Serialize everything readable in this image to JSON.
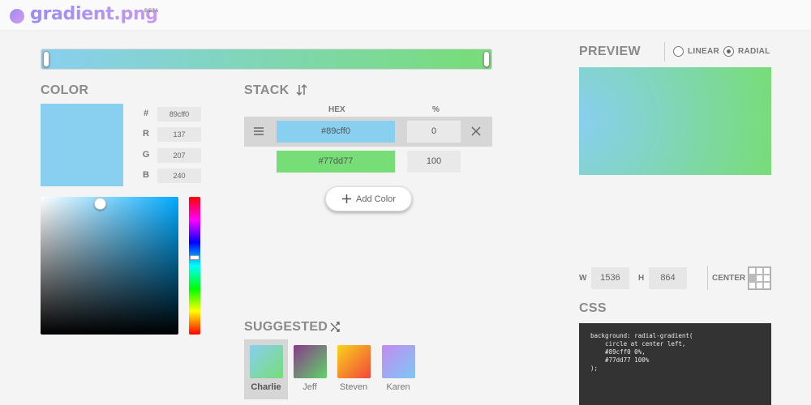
{
  "header": {
    "logo_text": "gradient.png",
    "badge": "BETA"
  },
  "gradient_bar": {
    "colors": [
      "#89cff0",
      "#77dd77"
    ],
    "stops_percent": [
      0,
      100
    ]
  },
  "color_panel": {
    "title": "COLOR",
    "current_hex": "#89cff0",
    "channels": [
      {
        "label": "#",
        "value": "89cff0"
      },
      {
        "label": "R",
        "value": "137"
      },
      {
        "label": "G",
        "value": "207"
      },
      {
        "label": "B",
        "value": "240"
      }
    ],
    "picker_hue_color": "#00aaff"
  },
  "stack": {
    "title": "STACK",
    "hex_header": "HEX",
    "percent_header": "%",
    "stops": [
      {
        "hex": "#89cff0",
        "percent": "0",
        "color": "#89cff0"
      },
      {
        "hex": "#77dd77",
        "percent": "100",
        "color": "#77dd77"
      }
    ],
    "add_label": "Add Color"
  },
  "suggested": {
    "title": "SUGGESTED",
    "items": [
      {
        "name": "Charlie",
        "from": "#89cff0",
        "to": "#77dd77",
        "selected": true
      },
      {
        "name": "Jeff",
        "from": "#8a3a8a",
        "to": "#5fd46a",
        "selected": false
      },
      {
        "name": "Steven",
        "from": "#f7d51a",
        "to": "#f2463a",
        "selected": false
      },
      {
        "name": "Karen",
        "from": "#c38bf0",
        "to": "#7cc8f5",
        "selected": false
      }
    ]
  },
  "preview": {
    "title": "PREVIEW",
    "linear_label": "LINEAR",
    "radial_label": "RADIAL",
    "mode": "radial"
  },
  "dimensions": {
    "w_label": "W",
    "w_value": "1536",
    "h_label": "H",
    "h_value": "864",
    "anchor_label": "CENTER"
  },
  "css": {
    "title": "CSS",
    "code": "background: radial-gradient(\n    circle at center left,\n    #89cff0 0%,\n    #77dd77 100%\n);"
  }
}
